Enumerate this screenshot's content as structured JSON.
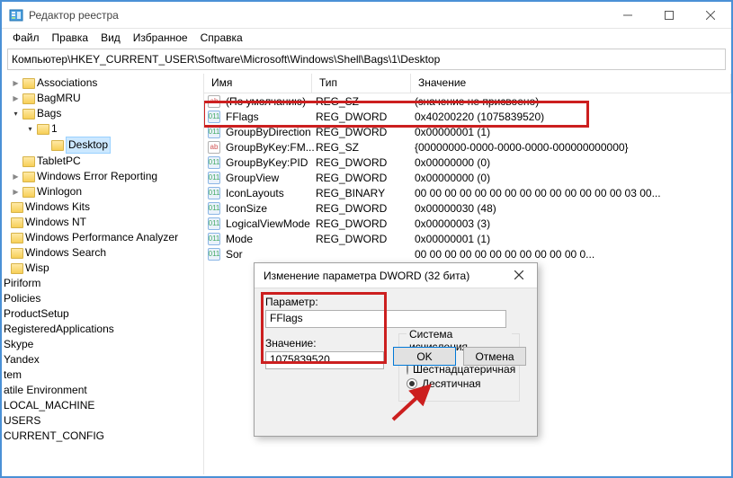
{
  "window": {
    "title": "Редактор реестра"
  },
  "menu": {
    "file": "Файл",
    "edit": "Правка",
    "view": "Вид",
    "favorites": "Избранное",
    "help": "Справка"
  },
  "path": "Компьютер\\HKEY_CURRENT_USER\\Software\\Microsoft\\Windows\\Shell\\Bags\\1\\Desktop",
  "columns": {
    "name": "Имя",
    "type": "Тип",
    "value": "Значение"
  },
  "tree": {
    "associations": "Associations",
    "bagmru": "BagMRU",
    "bags": "Bags",
    "one": "1",
    "desktop": "Desktop",
    "tabletpc": "TabletPC",
    "wer": "Windows Error Reporting",
    "winlogon": "Winlogon",
    "winkits": "Windows Kits",
    "winnt": "Windows NT",
    "wpa": "Windows Performance Analyzer",
    "winsearch": "Windows Search",
    "wisp": "Wisp",
    "piriform": "Piriform",
    "policies": "Policies",
    "productsetup": "ProductSetup",
    "regapps": "RegisteredApplications",
    "skype": "Skype",
    "yandex": "Yandex",
    "tem": "tem",
    "atile": "atile Environment",
    "lmachine": "LOCAL_MACHINE",
    "users": "USERS",
    "cconfig": "CURRENT_CONFIG"
  },
  "values": [
    {
      "icon": "ab",
      "name": "(По умолчанию)",
      "type": "REG_SZ",
      "value": "(значение не присвоено)"
    },
    {
      "icon": "nm",
      "name": "FFlags",
      "type": "REG_DWORD",
      "value": "0x40200220 (1075839520)"
    },
    {
      "icon": "nm",
      "name": "GroupByDirection",
      "type": "REG_DWORD",
      "value": "0x00000001 (1)"
    },
    {
      "icon": "ab",
      "name": "GroupByKey:FM...",
      "type": "REG_SZ",
      "value": "{00000000-0000-0000-0000-000000000000}"
    },
    {
      "icon": "nm",
      "name": "GroupByKey:PID",
      "type": "REG_DWORD",
      "value": "0x00000000 (0)"
    },
    {
      "icon": "nm",
      "name": "GroupView",
      "type": "REG_DWORD",
      "value": "0x00000000 (0)"
    },
    {
      "icon": "nm",
      "name": "IconLayouts",
      "type": "REG_BINARY",
      "value": "00 00 00 00 00 00 00 00 00 00 00 00 00 00 03 00..."
    },
    {
      "icon": "nm",
      "name": "IconSize",
      "type": "REG_DWORD",
      "value": "0x00000030 (48)"
    },
    {
      "icon": "nm",
      "name": "LogicalViewMode",
      "type": "REG_DWORD",
      "value": "0x00000003 (3)"
    },
    {
      "icon": "nm",
      "name": "Mode",
      "type": "REG_DWORD",
      "value": "0x00000001 (1)"
    },
    {
      "icon": "nm",
      "name": "Sor",
      "type": "",
      "value": "                                                                       00 00 00 00 00 00 00 00 00 00 00 0..."
    }
  ],
  "dialog": {
    "title": "Изменение параметра DWORD (32 бита)",
    "param_label": "Параметр:",
    "param_value": "FFlags",
    "value_label": "Значение:",
    "value_value": "1075839520",
    "radix_label": "Система исчисления",
    "radix_hex": "Шестнадцатеричная",
    "radix_dec": "Десятичная",
    "ok": "OK",
    "cancel": "Отмена"
  }
}
